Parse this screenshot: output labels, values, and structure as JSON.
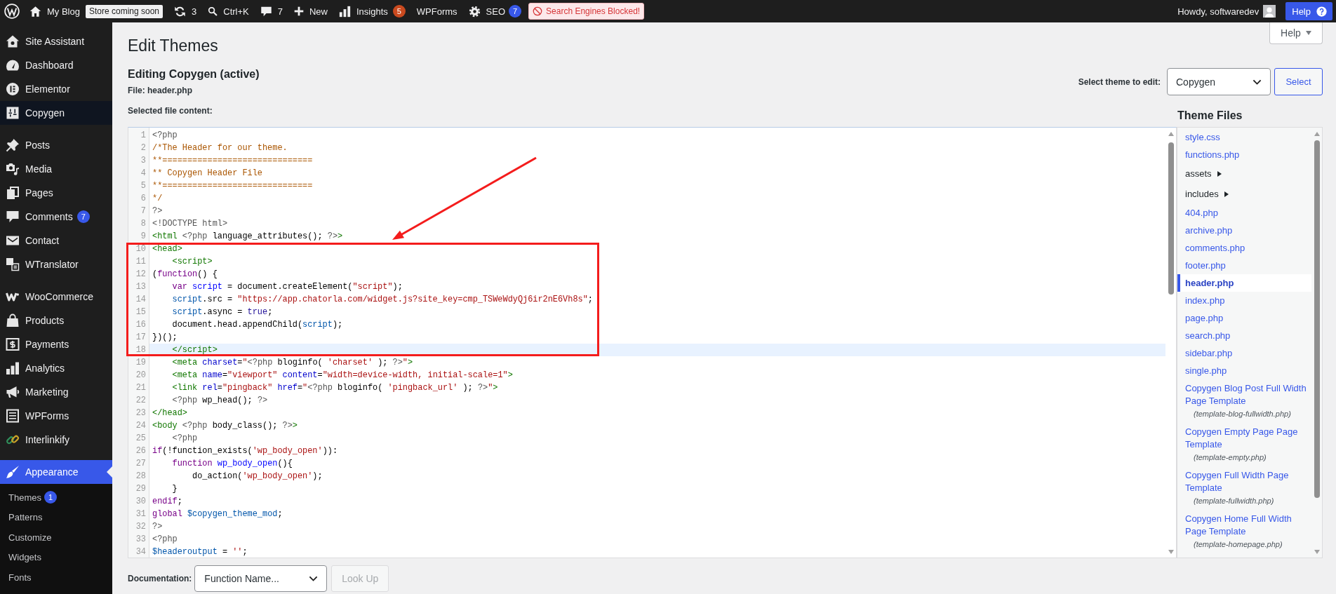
{
  "admin_bar": {
    "site_name": "My Blog",
    "store_badge": "Store coming soon",
    "updates_count": "3",
    "search_shortcut": "Ctrl+K",
    "comments_count": "7",
    "new_label": "New",
    "insights_label": "Insights",
    "insights_badge": "5",
    "wpforms_label": "WPForms",
    "seo_label": "SEO",
    "seo_badge": "7",
    "notice": "Search Engines Blocked!",
    "greeting": "Howdy, softwaredev",
    "help_label": "Help"
  },
  "sidebar": {
    "groups": [
      {
        "items": [
          {
            "label": "Site Assistant",
            "selected": false,
            "hovered": false
          },
          {
            "label": "Dashboard",
            "selected": false,
            "hovered": false
          },
          {
            "label": "Elementor",
            "selected": false,
            "hovered": false
          },
          {
            "label": "Copygen",
            "selected": false,
            "hovered": true
          }
        ]
      },
      {
        "items": [
          {
            "label": "Posts",
            "selected": false,
            "hovered": false
          },
          {
            "label": "Media",
            "selected": false,
            "hovered": false
          },
          {
            "label": "Pages",
            "selected": false,
            "hovered": false
          },
          {
            "label": "Comments",
            "badge": "7",
            "selected": false,
            "hovered": false
          },
          {
            "label": "Contact",
            "selected": false,
            "hovered": false
          },
          {
            "label": "WTranslator",
            "selected": false,
            "hovered": false
          }
        ]
      },
      {
        "items": [
          {
            "label": "WooCommerce",
            "selected": false,
            "hovered": false
          },
          {
            "label": "Products",
            "selected": false,
            "hovered": false
          },
          {
            "label": "Payments",
            "selected": false,
            "hovered": false
          },
          {
            "label": "Analytics",
            "selected": false,
            "hovered": false
          },
          {
            "label": "Marketing",
            "selected": false,
            "hovered": false
          },
          {
            "label": "WPForms",
            "selected": false,
            "hovered": false
          },
          {
            "label": "Interlinkify",
            "selected": false,
            "hovered": false
          }
        ]
      },
      {
        "items": [
          {
            "label": "Appearance",
            "selected": true,
            "hovered": false,
            "children": [
              {
                "label": "Themes",
                "badge": "1",
                "selected": false
              },
              {
                "label": "Patterns",
                "selected": false
              },
              {
                "label": "Customize",
                "selected": false
              },
              {
                "label": "Widgets",
                "selected": false
              },
              {
                "label": "Fonts",
                "selected": false
              }
            ]
          }
        ]
      }
    ]
  },
  "page": {
    "title": "Edit Themes",
    "help_tab": "Help",
    "subtitle": "Editing Copygen (active)",
    "file_label": "File: header.php",
    "theme_select_label": "Select theme to edit:",
    "theme_select_value": "Copygen",
    "select_button": "Select",
    "content_label": "Selected file content:"
  },
  "editor": {
    "segments": [
      {
        "annotated": false,
        "lines": [
          {
            "number": "1",
            "active": false,
            "tokens": [
              {
                "kind": "meta",
                "text": "<?php"
              }
            ]
          },
          {
            "number": "2",
            "active": false,
            "tokens": [
              {
                "kind": "comment",
                "text": "/*The Header for our theme."
              }
            ]
          },
          {
            "number": "3",
            "active": false,
            "tokens": [
              {
                "kind": "comment",
                "text": "**=============================="
              }
            ]
          },
          {
            "number": "4",
            "active": false,
            "tokens": [
              {
                "kind": "comment",
                "text": "** Copygen Header File"
              }
            ]
          },
          {
            "number": "5",
            "active": false,
            "tokens": [
              {
                "kind": "comment",
                "text": "**=============================="
              }
            ]
          },
          {
            "number": "6",
            "active": false,
            "tokens": [
              {
                "kind": "comment",
                "text": "*/"
              }
            ]
          },
          {
            "number": "7",
            "active": false,
            "tokens": [
              {
                "kind": "meta",
                "text": "?>"
              }
            ]
          },
          {
            "number": "8",
            "active": false,
            "tokens": [
              {
                "kind": "meta",
                "text": "<!DOCTYPE html>"
              }
            ]
          },
          {
            "number": "9",
            "active": false,
            "tokens": [
              {
                "kind": "tag",
                "text": "<html"
              },
              {
                "kind": "meta",
                "text": " <?php"
              },
              {
                "kind": "plain",
                "text": " language_attributes(); "
              },
              {
                "kind": "meta",
                "text": "?>"
              },
              {
                "kind": "tag",
                "text": ">"
              }
            ]
          }
        ]
      },
      {
        "annotated": true,
        "lines": [
          {
            "number": "10",
            "active": false,
            "tokens": [
              {
                "kind": "tag",
                "text": "<head>"
              }
            ]
          },
          {
            "number": "11",
            "active": false,
            "tokens": [
              {
                "kind": "tag",
                "text": "    <script>"
              }
            ]
          },
          {
            "number": "12",
            "active": false,
            "tokens": [
              {
                "kind": "plain",
                "text": "("
              },
              {
                "kind": "keyword",
                "text": "function"
              },
              {
                "kind": "plain",
                "text": "() {"
              }
            ]
          },
          {
            "number": "13",
            "active": false,
            "tokens": [
              {
                "kind": "keyword",
                "text": "    var"
              },
              {
                "kind": "def",
                "text": " script"
              },
              {
                "kind": "plain",
                "text": " = document.createElement("
              },
              {
                "kind": "string",
                "text": "\"script\""
              },
              {
                "kind": "plain",
                "text": ");"
              }
            ]
          },
          {
            "number": "14",
            "active": false,
            "tokens": [
              {
                "kind": "variable",
                "text": "    script"
              },
              {
                "kind": "plain",
                "text": ".src = "
              },
              {
                "kind": "string",
                "text": "\"https://app.chatorla.com/widget.js?site_key=cmp_TSWeWdyQj6ir2nE6Vh8s\""
              },
              {
                "kind": "plain",
                "text": ";"
              }
            ]
          },
          {
            "number": "15",
            "active": false,
            "tokens": [
              {
                "kind": "variable",
                "text": "    script"
              },
              {
                "kind": "plain",
                "text": ".async = "
              },
              {
                "kind": "atom",
                "text": "true"
              },
              {
                "kind": "plain",
                "text": ";"
              }
            ]
          },
          {
            "number": "16",
            "active": false,
            "tokens": [
              {
                "kind": "plain",
                "text": "    document.head.appendChild("
              },
              {
                "kind": "variable",
                "text": "script"
              },
              {
                "kind": "plain",
                "text": ");"
              }
            ]
          },
          {
            "number": "17",
            "active": false,
            "tokens": [
              {
                "kind": "plain",
                "text": "})();"
              }
            ]
          },
          {
            "number": "18",
            "active": true,
            "tokens": [
              {
                "kind": "tag",
                "text": "    </script>"
              }
            ]
          }
        ]
      },
      {
        "annotated": false,
        "lines": [
          {
            "number": "19",
            "active": false,
            "tokens": [
              {
                "kind": "tag",
                "text": "    <meta"
              },
              {
                "kind": "attribute",
                "text": " charset"
              },
              {
                "kind": "plain",
                "text": "="
              },
              {
                "kind": "string",
                "text": "\""
              },
              {
                "kind": "meta",
                "text": "<?php"
              },
              {
                "kind": "plain",
                "text": " bloginfo( "
              },
              {
                "kind": "string",
                "text": "'charset'"
              },
              {
                "kind": "plain",
                "text": " ); "
              },
              {
                "kind": "meta",
                "text": "?>"
              },
              {
                "kind": "string",
                "text": "\""
              },
              {
                "kind": "tag",
                "text": ">"
              }
            ]
          },
          {
            "number": "20",
            "active": false,
            "tokens": [
              {
                "kind": "tag",
                "text": "    <meta"
              },
              {
                "kind": "attribute",
                "text": " name"
              },
              {
                "kind": "plain",
                "text": "="
              },
              {
                "kind": "string",
                "text": "\"viewport\""
              },
              {
                "kind": "attribute",
                "text": " content"
              },
              {
                "kind": "plain",
                "text": "="
              },
              {
                "kind": "string",
                "text": "\"width=device-width, initial-scale=1\""
              },
              {
                "kind": "tag",
                "text": ">"
              }
            ]
          },
          {
            "number": "21",
            "active": false,
            "tokens": [
              {
                "kind": "tag",
                "text": "    <link"
              },
              {
                "kind": "attribute",
                "text": " rel"
              },
              {
                "kind": "plain",
                "text": "="
              },
              {
                "kind": "string",
                "text": "\"pingback\""
              },
              {
                "kind": "attribute",
                "text": " href"
              },
              {
                "kind": "plain",
                "text": "="
              },
              {
                "kind": "string",
                "text": "\""
              },
              {
                "kind": "meta",
                "text": "<?php"
              },
              {
                "kind": "plain",
                "text": " bloginfo( "
              },
              {
                "kind": "string",
                "text": "'pingback_url'"
              },
              {
                "kind": "plain",
                "text": " ); "
              },
              {
                "kind": "meta",
                "text": "?>"
              },
              {
                "kind": "string",
                "text": "\""
              },
              {
                "kind": "tag",
                "text": ">"
              }
            ]
          },
          {
            "number": "22",
            "active": false,
            "tokens": [
              {
                "kind": "meta",
                "text": "    <?php"
              },
              {
                "kind": "plain",
                "text": " wp_head(); "
              },
              {
                "kind": "meta",
                "text": "?>"
              }
            ]
          },
          {
            "number": "23",
            "active": false,
            "tokens": [
              {
                "kind": "tag",
                "text": "</head>"
              }
            ]
          },
          {
            "number": "24",
            "active": false,
            "tokens": [
              {
                "kind": "tag",
                "text": "<body"
              },
              {
                "kind": "meta",
                "text": " <?php"
              },
              {
                "kind": "plain",
                "text": " body_class(); "
              },
              {
                "kind": "meta",
                "text": "?>"
              },
              {
                "kind": "tag",
                "text": ">"
              }
            ]
          },
          {
            "number": "25",
            "active": false,
            "tokens": [
              {
                "kind": "meta",
                "text": "    <?php"
              }
            ]
          },
          {
            "number": "26",
            "active": false,
            "tokens": [
              {
                "kind": "keyword",
                "text": "if"
              },
              {
                "kind": "plain",
                "text": "(!function_exists("
              },
              {
                "kind": "string",
                "text": "'wp_body_open'"
              },
              {
                "kind": "plain",
                "text": ")):"
              }
            ]
          },
          {
            "number": "27",
            "active": false,
            "tokens": [
              {
                "kind": "keyword",
                "text": "    function"
              },
              {
                "kind": "def",
                "text": " wp_body_open"
              },
              {
                "kind": "plain",
                "text": "(){"
              }
            ]
          },
          {
            "number": "28",
            "active": false,
            "tokens": [
              {
                "kind": "plain",
                "text": "        do_action("
              },
              {
                "kind": "string",
                "text": "'wp_body_open'"
              },
              {
                "kind": "plain",
                "text": ");"
              }
            ]
          },
          {
            "number": "29",
            "active": false,
            "tokens": [
              {
                "kind": "plain",
                "text": "    }"
              }
            ]
          },
          {
            "number": "30",
            "active": false,
            "tokens": [
              {
                "kind": "keyword",
                "text": "endif"
              },
              {
                "kind": "plain",
                "text": ";"
              }
            ]
          },
          {
            "number": "31",
            "active": false,
            "tokens": [
              {
                "kind": "keyword",
                "text": "global"
              },
              {
                "kind": "variable",
                "text": " $copygen_theme_mod"
              },
              {
                "kind": "plain",
                "text": ";"
              }
            ]
          },
          {
            "number": "32",
            "active": false,
            "tokens": [
              {
                "kind": "meta",
                "text": "?>"
              }
            ]
          },
          {
            "number": "33",
            "active": false,
            "tokens": [
              {
                "kind": "meta",
                "text": "<?php"
              }
            ]
          },
          {
            "number": "34",
            "active": false,
            "tokens": [
              {
                "kind": "variable",
                "text": "$headeroutput"
              },
              {
                "kind": "plain",
                "text": " = "
              },
              {
                "kind": "string",
                "text": "''"
              },
              {
                "kind": "plain",
                "text": ";"
              }
            ]
          }
        ]
      }
    ]
  },
  "theme_files": {
    "title": "Theme Files",
    "items": [
      {
        "kind": "file",
        "name": "style.css",
        "selected": false
      },
      {
        "kind": "file",
        "name": "functions.php",
        "selected": false
      },
      {
        "kind": "folder",
        "name": "assets",
        "expanded": false,
        "selected": false
      },
      {
        "kind": "folder",
        "name": "includes",
        "expanded": false,
        "selected": false
      },
      {
        "kind": "file",
        "name": "404.php",
        "selected": false
      },
      {
        "kind": "file",
        "name": "archive.php",
        "selected": false
      },
      {
        "kind": "file",
        "name": "comments.php",
        "selected": false
      },
      {
        "kind": "file",
        "name": "footer.php",
        "selected": false
      },
      {
        "kind": "file",
        "name": "header.php",
        "selected": true
      },
      {
        "kind": "file",
        "name": "index.php",
        "selected": false
      },
      {
        "kind": "file",
        "name": "page.php",
        "selected": false
      },
      {
        "kind": "file",
        "name": "search.php",
        "selected": false
      },
      {
        "kind": "file",
        "name": "sidebar.php",
        "selected": false
      },
      {
        "kind": "file",
        "name": "single.php",
        "selected": false
      },
      {
        "kind": "template",
        "name": "Copygen Blog Post Full Width Page Template",
        "file": "(template-blog-fullwidth.php)",
        "selected": false
      },
      {
        "kind": "template",
        "name": "Copygen Empty Page Page Template",
        "file": "(template-empty.php)",
        "selected": false
      },
      {
        "kind": "template",
        "name": "Copygen Full Width Page Template",
        "file": "(template-fullwidth.php)",
        "selected": false
      },
      {
        "kind": "template",
        "name": "Copygen Home Full Width Page Template",
        "file": "(template-homepage.php)",
        "selected": false
      }
    ]
  },
  "documentation": {
    "label": "Documentation:",
    "value": "Function Name...",
    "button": "Look Up",
    "button_disabled": true
  }
}
